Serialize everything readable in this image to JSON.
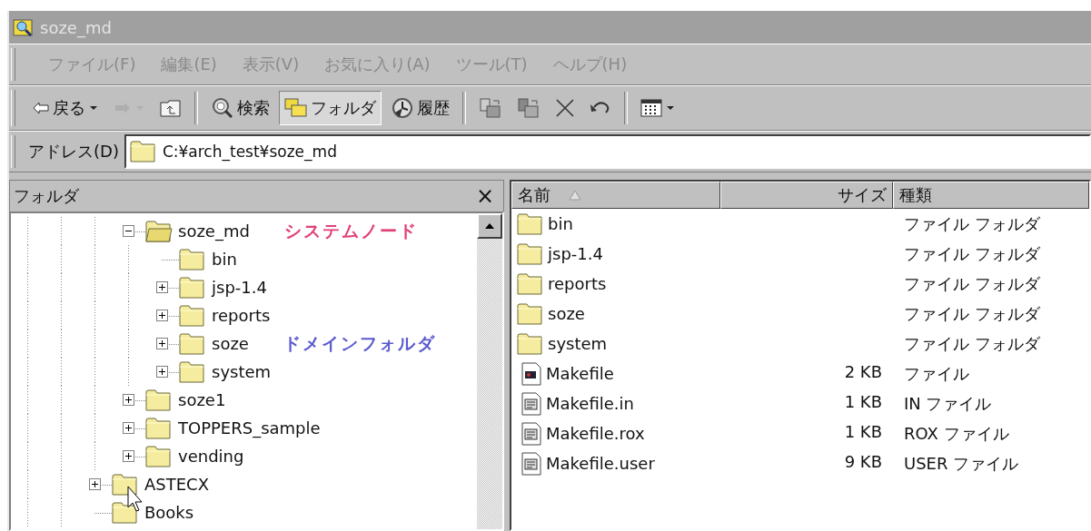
{
  "window": {
    "title": "soze_md"
  },
  "menu": [
    {
      "label": "ファイル(F)"
    },
    {
      "label": "編集(E)"
    },
    {
      "label": "表示(V)"
    },
    {
      "label": "お気に入り(A)"
    },
    {
      "label": "ツール(T)"
    },
    {
      "label": "ヘルプ(H)"
    }
  ],
  "toolbar": [
    {
      "kind": "back",
      "label": "戻る",
      "dropdown": true,
      "disabled": false,
      "selected": false
    },
    {
      "kind": "forward",
      "dropdown": true,
      "disabled": true,
      "selected": false
    },
    {
      "kind": "up",
      "dropdown": false,
      "disabled": false,
      "selected": false
    },
    {
      "kind": "separator"
    },
    {
      "kind": "search",
      "label": "検索",
      "dropdown": false,
      "disabled": false,
      "selected": false
    },
    {
      "kind": "folders",
      "label": "フォルダ",
      "dropdown": false,
      "disabled": false,
      "selected": true
    },
    {
      "kind": "history",
      "label": "履歴",
      "dropdown": false,
      "disabled": false,
      "selected": false
    },
    {
      "kind": "separator"
    },
    {
      "kind": "move",
      "dropdown": false,
      "disabled": false,
      "selected": false
    },
    {
      "kind": "copy",
      "dropdown": false,
      "disabled": false,
      "selected": false
    },
    {
      "kind": "delete",
      "dropdown": false,
      "disabled": false,
      "selected": false
    },
    {
      "kind": "undo",
      "dropdown": false,
      "disabled": false,
      "selected": false
    },
    {
      "kind": "separator"
    },
    {
      "kind": "views",
      "dropdown": true,
      "disabled": false,
      "selected": false
    }
  ],
  "address": {
    "label": "アドレス(D)",
    "value": "C:¥arch_test¥soze_md"
  },
  "folder_pane": {
    "title": "フォルダ",
    "close": "×",
    "nodes": [
      {
        "children": [
          {
            "label": "soze_md",
            "expandable": true,
            "expanded": true,
            "note": "システムノード",
            "color": "#e0407a",
            "children": [
              {
                "label": "bin",
                "expandable": false,
                "expanded": false
              },
              {
                "label": "jsp-1.4",
                "expandable": true,
                "expanded": false
              },
              {
                "label": "reports",
                "expandable": true,
                "expanded": false
              },
              {
                "label": "soze",
                "expandable": true,
                "expanded": false,
                "note": "ドメインフォルダ",
                "color": "#5a5ad0"
              },
              {
                "label": "system",
                "expandable": true,
                "expanded": false
              }
            ]
          },
          {
            "label": "soze1",
            "expandable": true,
            "expanded": false
          },
          {
            "label": "TOPPERS_sample",
            "expandable": true,
            "expanded": false
          },
          {
            "label": "vending",
            "expandable": true,
            "expanded": false
          }
        ]
      },
      {
        "label": "ASTECX",
        "expandable": true,
        "expanded": false
      },
      {
        "label": "Books",
        "expandable": false,
        "expanded": false
      }
    ]
  },
  "file_list": {
    "columns": [
      {
        "label": "名前",
        "sorted": true
      },
      {
        "label": "サイズ",
        "sorted": false
      },
      {
        "label": "種類",
        "sorted": false
      }
    ],
    "rows": [
      {
        "kind": "folder",
        "name": "bin",
        "type": "ファイル フォルダ"
      },
      {
        "kind": "folder",
        "name": "jsp-1.4",
        "type": "ファイル フォルダ"
      },
      {
        "kind": "folder",
        "name": "reports",
        "type": "ファイル フォルダ"
      },
      {
        "kind": "folder",
        "name": "soze",
        "type": "ファイル フォルダ"
      },
      {
        "kind": "folder",
        "name": "system",
        "type": "ファイル フォルダ"
      },
      {
        "kind": "program",
        "name": "Makefile",
        "size": "2 KB",
        "type": "ファイル"
      },
      {
        "kind": "document",
        "name": "Makefile.in",
        "size": "1 KB",
        "type": "IN ファイル"
      },
      {
        "kind": "document",
        "name": "Makefile.rox",
        "size": "1 KB",
        "type": "ROX ファイル"
      },
      {
        "kind": "document",
        "name": "Makefile.user",
        "size": "9 KB",
        "type": "USER ファイル"
      }
    ]
  }
}
